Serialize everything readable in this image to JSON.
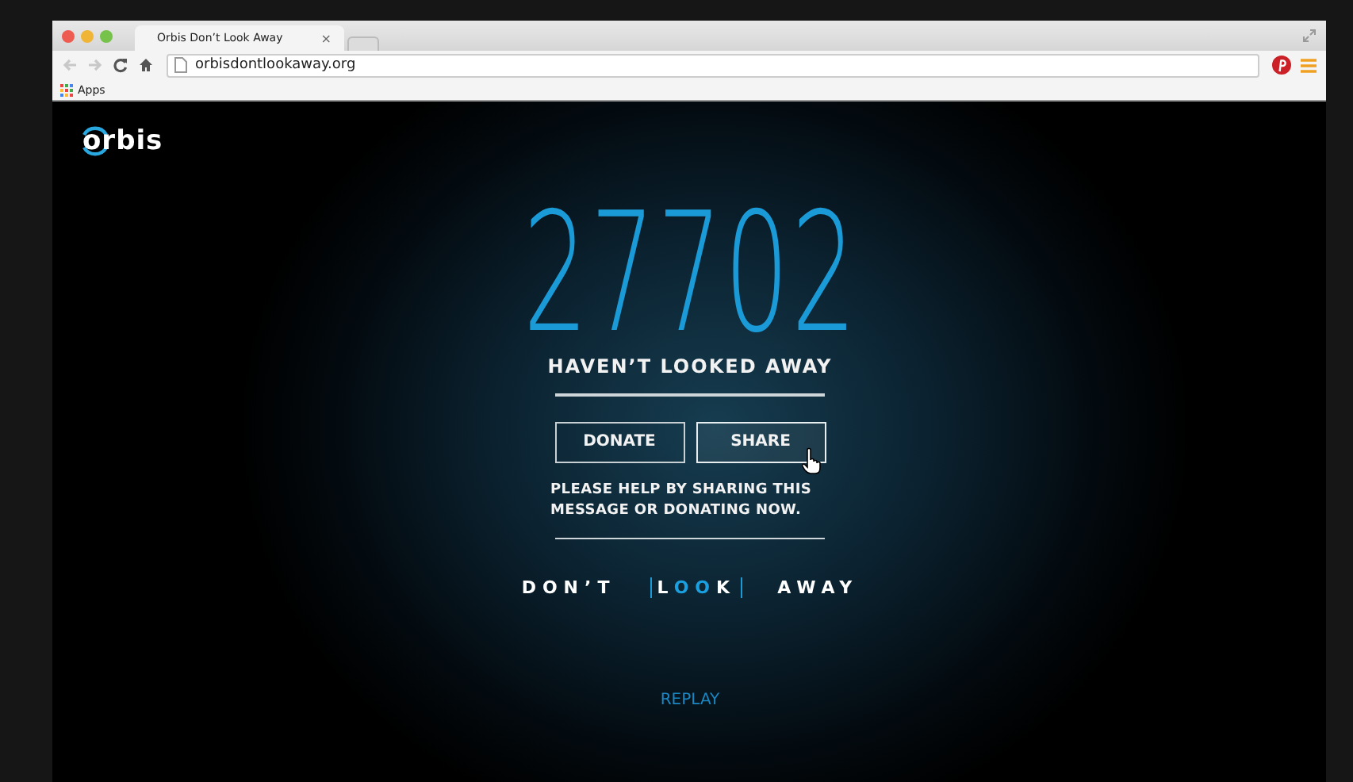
{
  "browser": {
    "tab_title": "Orbis Don’t Look Away",
    "tab_close": "×",
    "url": "orbisdontlookaway.org",
    "bookmarks": [
      {
        "label": "Apps"
      }
    ]
  },
  "page": {
    "logo": "orbis",
    "counter": "27702",
    "headline": "HAVEN’T LOOKED AWAY",
    "buttons": [
      {
        "label": "DONATE",
        "hovered": false
      },
      {
        "label": "SHARE",
        "hovered": true
      }
    ],
    "message": "PLEASE HELP BY SHARING THIS MESSAGE OR DONATING NOW.",
    "tagline": {
      "before": "DON’T",
      "look_start": "L",
      "look_highlight": "OO",
      "look_end": "K",
      "after": "AWAY"
    },
    "replay": "REPLAY"
  }
}
